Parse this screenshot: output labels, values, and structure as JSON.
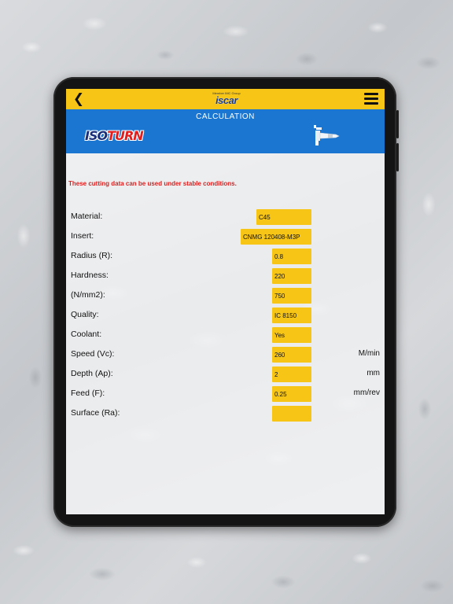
{
  "header": {
    "logo_tag": "Member IMC Group",
    "logo_text": "iscar",
    "title": "CALCULATION"
  },
  "banner": {
    "brand_iso": "ISO",
    "brand_turn": "TURN",
    "tool_icon": "turning-tool-icon"
  },
  "warning": "These cutting data can be used under stable conditions.",
  "rows": [
    {
      "label": "Material:",
      "value": "C45",
      "unit": ""
    },
    {
      "label": "Insert:",
      "value": "CNMG 120408-M3P",
      "unit": ""
    },
    {
      "label": "Radius (R):",
      "value": "0.8",
      "unit": ""
    },
    {
      "label": "Hardness:",
      "value": "220",
      "unit": ""
    },
    {
      "label": "(N/mm2):",
      "value": "750",
      "unit": ""
    },
    {
      "label": "Quality:",
      "value": "IC 8150",
      "unit": ""
    },
    {
      "label": "Coolant:",
      "value": "Yes",
      "unit": ""
    },
    {
      "label": "Speed (Vc):",
      "value": "260",
      "unit": "M/min"
    },
    {
      "label": "Depth (Ap):",
      "value": "2",
      "unit": "mm"
    },
    {
      "label": "Feed (F):",
      "value": "0.25",
      "unit": "mm/rev"
    },
    {
      "label": "Surface (Ra):",
      "value": "",
      "unit": ""
    }
  ],
  "colors": {
    "topbar": "#f6c516",
    "banner": "#1b76d1",
    "field": "#f6c516",
    "warning": "#e02020"
  }
}
